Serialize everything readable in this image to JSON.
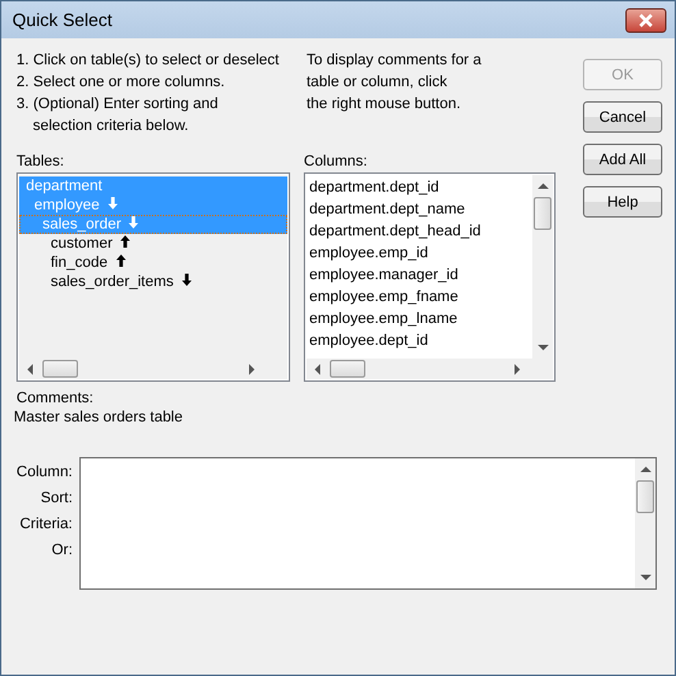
{
  "window": {
    "title": "Quick Select"
  },
  "instructions": [
    "1. Click on table(s) to select or deselect",
    "2. Select one or more columns.",
    "3. (Optional) Enter sorting and",
    "selection criteria below."
  ],
  "hint": [
    "To display comments for a",
    "table or column, click",
    "the right mouse button."
  ],
  "buttons": [
    {
      "label": "OK",
      "disabled": true
    },
    {
      "label": "Cancel",
      "disabled": false
    },
    {
      "label": "Add All",
      "disabled": false
    },
    {
      "label": "Help",
      "disabled": false
    }
  ],
  "tables": {
    "label": "Tables:",
    "items": [
      {
        "name": "department",
        "selected": true,
        "focused": false,
        "children": [
          {
            "name": "employee",
            "kind": "down",
            "selected": true,
            "focused": false,
            "children": [
              {
                "name": "sales_order",
                "kind": "down",
                "selected": true,
                "focused": true,
                "children": [
                  {
                    "name": "customer",
                    "kind": "up",
                    "selected": false,
                    "focused": false
                  },
                  {
                    "name": "fin_code",
                    "kind": "up",
                    "selected": false,
                    "focused": false
                  },
                  {
                    "name": "sales_order_items",
                    "kind": "down",
                    "selected": false,
                    "focused": false
                  }
                ]
              }
            ]
          }
        ]
      }
    ]
  },
  "columns": {
    "label": "Columns:",
    "items": [
      {
        "name": "department.dept_id",
        "selected": false
      },
      {
        "name": "department.dept_name",
        "selected": false
      },
      {
        "name": "department.dept_head_id",
        "selected": false
      },
      {
        "name": "employee.emp_id",
        "selected": false
      },
      {
        "name": "employee.manager_id",
        "selected": false
      },
      {
        "name": "employee.emp_fname",
        "selected": false
      },
      {
        "name": "employee.emp_lname",
        "selected": false
      },
      {
        "name": "employee.dept_id",
        "selected": false
      }
    ]
  },
  "comments": {
    "label": "Comments:",
    "text": "Master sales orders table"
  },
  "criteria": {
    "row_labels": [
      "Column:",
      "Sort:",
      "Criteria:",
      "Or:"
    ]
  }
}
